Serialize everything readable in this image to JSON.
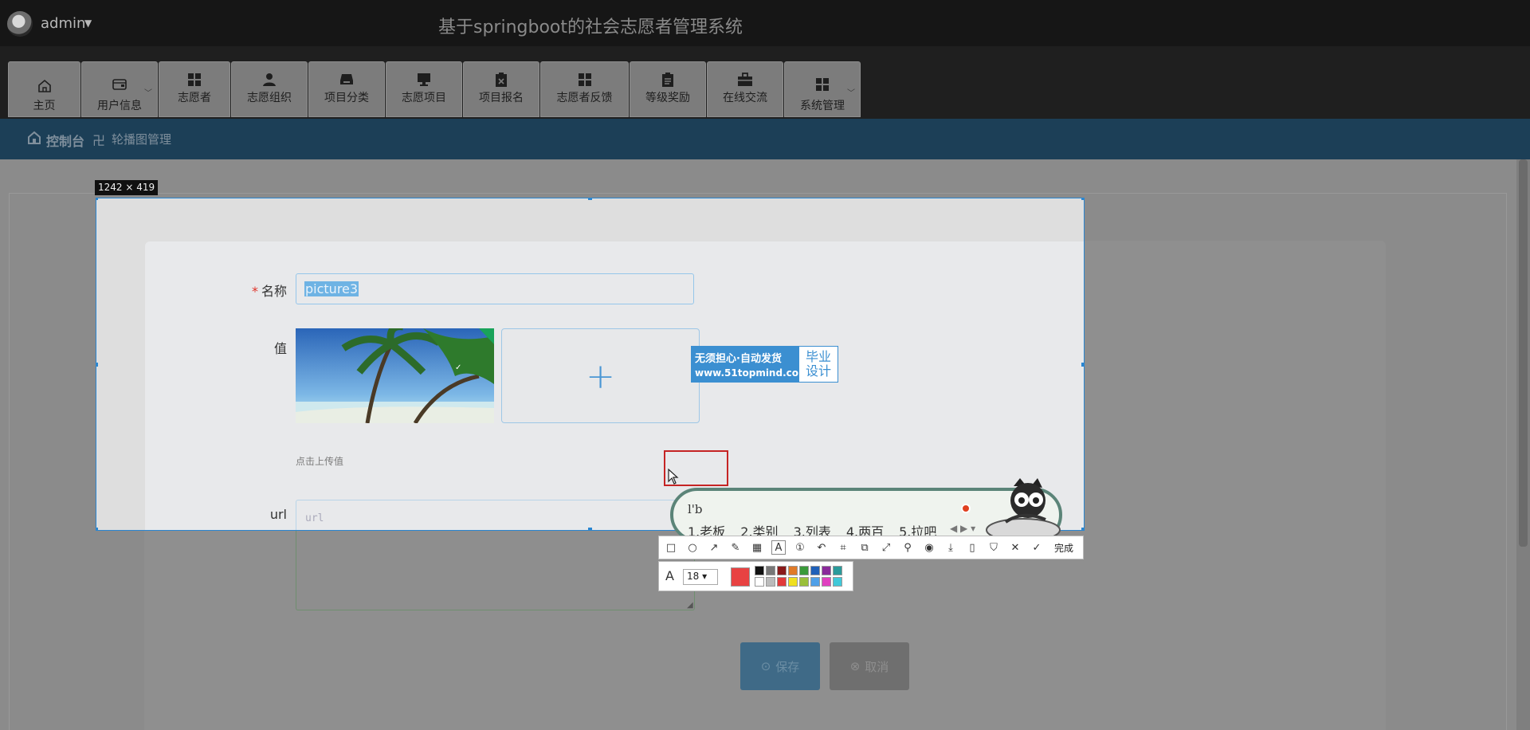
{
  "header": {
    "username": "admin",
    "site_title": "基于springboot的社会志愿者管理系统"
  },
  "nav": {
    "items": [
      {
        "label": "主页",
        "icon": "home-icon"
      },
      {
        "label": "用户信息",
        "icon": "wallet-icon",
        "has_dropdown": true
      },
      {
        "label": "志愿者",
        "icon": "grid-icon"
      },
      {
        "label": "志愿组织",
        "icon": "user-icon"
      },
      {
        "label": "项目分类",
        "icon": "tray-icon"
      },
      {
        "label": "志愿项目",
        "icon": "monitor-icon"
      },
      {
        "label": "项目报名",
        "icon": "clipboard-x-icon"
      },
      {
        "label": "志愿者反馈",
        "icon": "grid-icon"
      },
      {
        "label": "等级奖励",
        "icon": "clipboard-icon"
      },
      {
        "label": "在线交流",
        "icon": "briefcase-icon"
      },
      {
        "label": "系统管理",
        "icon": "grid-icon",
        "has_dropdown": true
      }
    ]
  },
  "breadcrumb": {
    "root": "控制台",
    "separator": "卍",
    "current": "轮播图管理"
  },
  "form": {
    "name_label": "名称",
    "name_value": "picture3",
    "value_label": "值",
    "upload_hint": "点击上传值",
    "url_label": "url",
    "url_placeholder": "url",
    "save_label": "保存",
    "cancel_label": "取消"
  },
  "capture": {
    "size_label": "1242 × 419",
    "done_label": "完成",
    "font_size": "18",
    "current_color": "#e84242"
  },
  "watermark": {
    "line1": "无须担心·自动发货",
    "line2": "www.51topmind.com",
    "right_top": "毕业",
    "right_bottom": "设计"
  },
  "ime": {
    "input": "l'b",
    "candidates": [
      "1.老板",
      "2.类别",
      "3.列表",
      "4.两百",
      "5.拉吧"
    ]
  },
  "colors": {
    "accent": "#2a86d1",
    "breadcrumb_bg": "#1c3f57",
    "required": "#e0342a",
    "save_btn": "#3f6a87"
  }
}
